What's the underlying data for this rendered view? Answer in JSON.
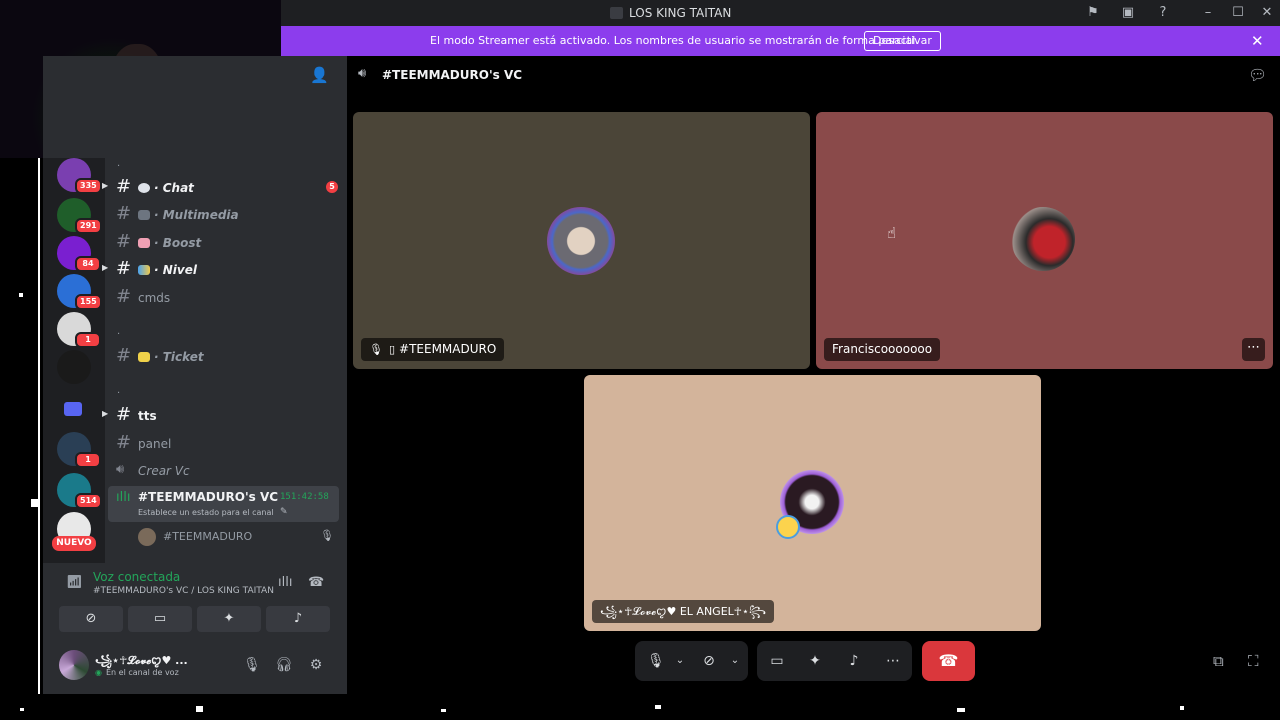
{
  "window": {
    "title": "LOS KING TAITAN",
    "controls": [
      "flag-icon",
      "inbox-icon",
      "help-icon",
      "minimize-icon",
      "maximize-icon",
      "close-icon"
    ]
  },
  "banner": {
    "text": "El modo Streamer está activado. Los nombres de usuario se mostrarán de forma parcial.",
    "button": "Desactivar"
  },
  "servers": [
    {
      "badge": "335",
      "color": "#7a3fb0"
    },
    {
      "badge": "291",
      "color": "#1f5e2a"
    },
    {
      "badge": "84",
      "color": "#7a1fd0"
    },
    {
      "badge": "155",
      "color": "#2b6fd6"
    },
    {
      "badge": "1",
      "color": "#d9d9d9"
    },
    {
      "badge": "",
      "color": "#1a1a1a"
    },
    {
      "badge": "1",
      "color": "#2a3f55"
    },
    {
      "badge": "514",
      "color": "#1a7a8a"
    },
    {
      "badge": "",
      "color": "#e8e8e8"
    }
  ],
  "nuevo_label": "NUEVO",
  "channels": {
    "chat": {
      "label": "· Chat",
      "unread": "5"
    },
    "multimedia": {
      "label": "· Multimedia"
    },
    "boost": {
      "label": "· Boost"
    },
    "nivel": {
      "label": "· Nivel"
    },
    "cmds": {
      "label": "cmds"
    },
    "ticket": {
      "label": "· Ticket"
    },
    "tts": {
      "label": "tts"
    },
    "panel": {
      "label": "panel"
    },
    "crear_vc": {
      "label": "Crear Vc"
    },
    "category_1": ".",
    "category_2": ".",
    "category_3": "."
  },
  "voice_channel": {
    "name": "#TEEMMADURO's VC",
    "timer": "151:42:58",
    "status_prompt": "Establece un estado para el canal",
    "member": "#TEEMMADURO"
  },
  "voice_panel": {
    "status": "Voz conectada",
    "channel": "#TEEMMADURO's VC / LOS KING TAITAN"
  },
  "user": {
    "name": "꧁⋆☥𝓛𝓸𝓿𝓮ꨄ♥ ...",
    "status": "En el canal de voz"
  },
  "main": {
    "header": "#TEEMMADURO's VC",
    "tiles": [
      {
        "name": "#TEEMMADURO",
        "bg": "#4b4538"
      },
      {
        "name": "Franciscooooooo",
        "bg": "#8a4a4a"
      },
      {
        "name": "꧁⋆☥𝓛𝓸𝓿𝓮ꨄ♥ EL ANGEL☥⋆꧂",
        "bg": "#d3b49b"
      }
    ]
  },
  "colors": {
    "accent": "#8c3ded",
    "online": "#23a55a",
    "danger": "#da373c"
  }
}
